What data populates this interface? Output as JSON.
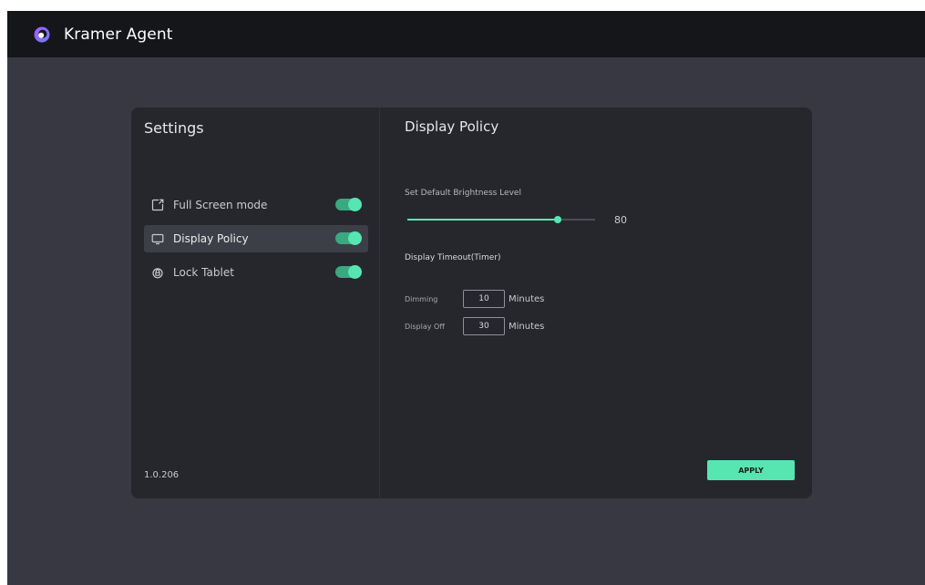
{
  "app": {
    "title": "Kramer Agent",
    "icon": "kramer-logo-icon"
  },
  "sidebar": {
    "title": "Settings",
    "items": [
      {
        "label": "Full Screen mode",
        "icon": "fullscreen-icon",
        "enabled": true,
        "active": false
      },
      {
        "label": "Display Policy",
        "icon": "display-icon",
        "enabled": true,
        "active": true
      },
      {
        "label": "Lock Tablet",
        "icon": "lock-icon",
        "enabled": true,
        "active": false
      }
    ],
    "version": "1.0.206"
  },
  "panel": {
    "title": "Display Policy",
    "brightness": {
      "label": "Set Default Brightness Level",
      "value": "80",
      "percent": 80
    },
    "timeout": {
      "label": "Display Timeout(Timer)",
      "dimming": {
        "label": "Dimming",
        "value": "10",
        "unit": "Minutes"
      },
      "display_off": {
        "label": "Display Off",
        "value": "30",
        "unit": "Minutes"
      }
    },
    "apply_label": "APPLY"
  },
  "colors": {
    "accent": "#57e6b2",
    "titlebar": "#15161a",
    "background": "#373841",
    "card": "#26272c"
  }
}
